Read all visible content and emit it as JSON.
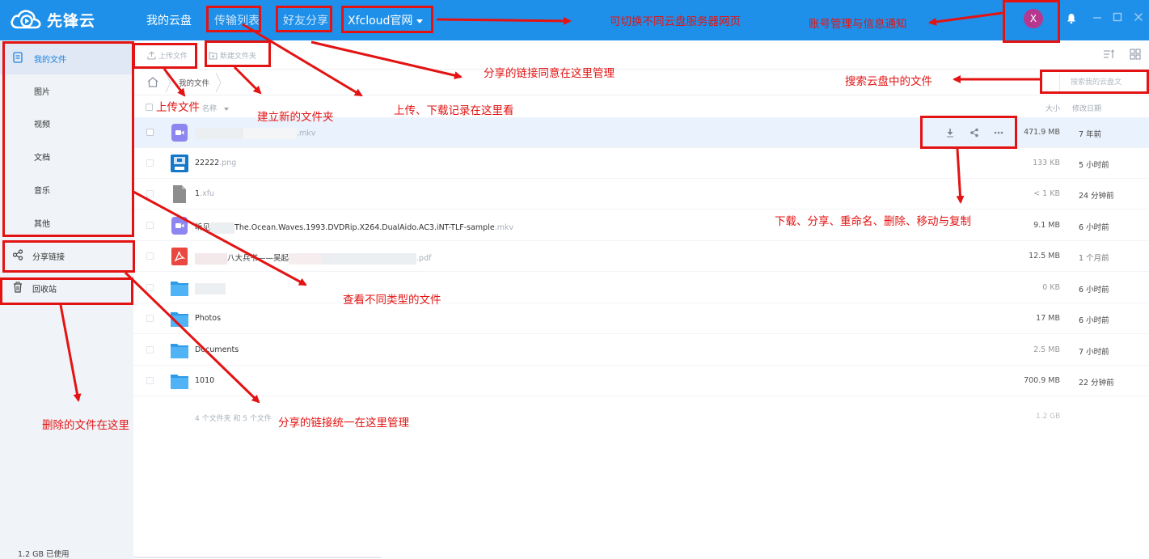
{
  "app": {
    "logo_text": "先锋云",
    "nav": [
      "我的云盘",
      "传输列表",
      "好友分享",
      "Xfcloud官网"
    ],
    "avatar_letter": "X"
  },
  "sidebar": {
    "items": [
      "我的文件",
      "图片",
      "视频",
      "文档",
      "音乐",
      "其他",
      "分享链接",
      "回收站"
    ],
    "usage": "1.2 GB 已使用"
  },
  "toolbar": {
    "upload": "上传文件",
    "new_folder": "新建文件夹"
  },
  "breadcrumb": "我的文件",
  "search": {
    "placeholder": "搜索我的云盘文"
  },
  "table": {
    "col_name": "名称",
    "col_size": "大小",
    "col_date": "修改日期",
    "rows": [
      {
        "name": "",
        "ext": ".mkv",
        "size": "471.9 MB",
        "date": "7 年前",
        "icon": "video-file-icon"
      },
      {
        "name": "22222",
        "ext": ".png",
        "size": "133 KB",
        "date": "5 小时前",
        "icon": "image-file-icon"
      },
      {
        "name": "1",
        "ext": ".xfu",
        "size": "< 1 KB",
        "date": "24 分钟前",
        "icon": "generic-file-icon"
      },
      {
        "name": "听见",
        "name_rest": "The.Ocean.Waves.1993.DVDRip.X264.DualAido.AC3.iNT-TLF-sample",
        "ext": ".mkv",
        "size": "9.1 MB",
        "date": "6 小时前",
        "icon": "video-file-icon"
      },
      {
        "name": "八大兵书——吴起",
        "ext": ".pdf",
        "size": "12.5 MB",
        "date": "1 个月前",
        "icon": "pdf-file-icon"
      },
      {
        "name": "",
        "ext": "",
        "size": "0 KB",
        "date": "6 小时前",
        "icon": "folder-icon"
      },
      {
        "name": "Photos",
        "ext": "",
        "size": "17 MB",
        "date": "6 小时前",
        "icon": "folder-icon"
      },
      {
        "name": "Documents",
        "ext": "",
        "size": "2.5 MB",
        "date": "7 小时前",
        "icon": "folder-icon"
      },
      {
        "name": "1010",
        "ext": "",
        "size": "700.9 MB",
        "date": "22 分钟前",
        "icon": "folder-icon"
      }
    ],
    "summary": "4 个文件夹 和 5 个文件",
    "total": "1.2 GB"
  },
  "annotations": {
    "switch_site": "可切换不同云盘服务器网页",
    "account": "账号管理与信息通知",
    "share_manage_top": "分享的链接同意在这里管理",
    "transfer_record": "上传、下载记录在这里看",
    "search_tip": "搜索云盘中的文件",
    "upload": "上传文件",
    "new_folder": "建立新的文件夹",
    "file_actions": "下载、分享、重命名、删除、移动与复制",
    "file_types": "查看不同类型的文件",
    "recycle": "删除的文件在这里",
    "share_manage_bottom": "分享的链接统一在这里管理"
  },
  "colors": {
    "topbar": "#1e90ea",
    "annotation_red": "#e31313",
    "sidebar_bg": "#f0f3f7",
    "highlight_row": "#eaf3fd"
  }
}
